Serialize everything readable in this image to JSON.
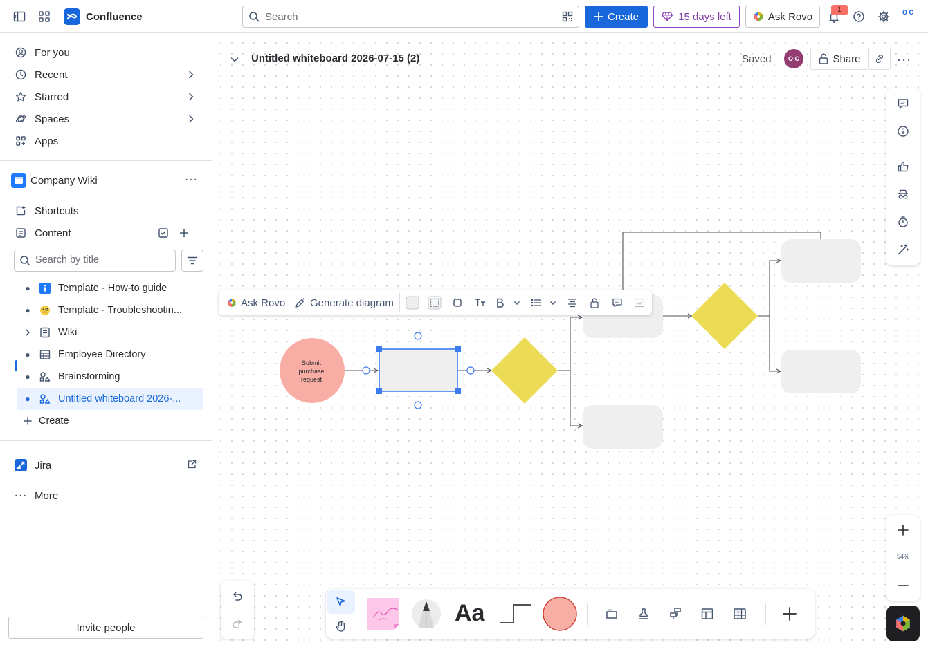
{
  "topbar": {
    "app_name": "Confluence",
    "search_placeholder": "Search",
    "create_label": "Create",
    "trial_label": "15 days left",
    "ask_rovo_label": "Ask Rovo",
    "notification_count": "1",
    "avatar_initials": "O C"
  },
  "sidebar": {
    "nav": [
      {
        "label": "For you",
        "icon": "user-circle-icon"
      },
      {
        "label": "Recent",
        "icon": "clock-icon"
      },
      {
        "label": "Starred",
        "icon": "star-icon"
      },
      {
        "label": "Spaces",
        "icon": "planet-icon"
      },
      {
        "label": "Apps",
        "icon": "apps-icon"
      }
    ],
    "space_name": "Company Wiki",
    "shortcuts_label": "Shortcuts",
    "content_label": "Content",
    "title_search_placeholder": "Search by title",
    "tree": [
      {
        "label": "Template - How-to guide",
        "icon": "info-icon"
      },
      {
        "label": "Template - Troubleshootin...",
        "icon": "emoji-icon"
      },
      {
        "label": "Wiki",
        "icon": "page-icon"
      },
      {
        "label": "Employee Directory",
        "icon": "database-icon"
      },
      {
        "label": "Brainstorming",
        "icon": "whiteboard-icon"
      },
      {
        "label": "Untitled whiteboard 2026-...",
        "icon": "whiteboard-icon"
      }
    ],
    "create_label": "Create",
    "jira_label": "Jira",
    "more_label": "More",
    "invite_label": "Invite people"
  },
  "main": {
    "title": "Untitled whiteboard 2026-07-15 (2)",
    "status": "Saved",
    "avatar_initials": "O C",
    "share_label": "Share",
    "zoom_level": "54%"
  },
  "floating_toolbar": {
    "ask_rovo_label": "Ask Rovo",
    "generate_label": "Generate diagram"
  },
  "canvas": {
    "circle_label": "Submit purchase request"
  },
  "colors": {
    "brand_blue": "#1868db",
    "trial_purple": "#803fa5",
    "circle_fill": "#f9aea5",
    "diamond_fill": "#ecdb55",
    "box_fill": "#efefef",
    "selection": "#3d7cf0"
  }
}
